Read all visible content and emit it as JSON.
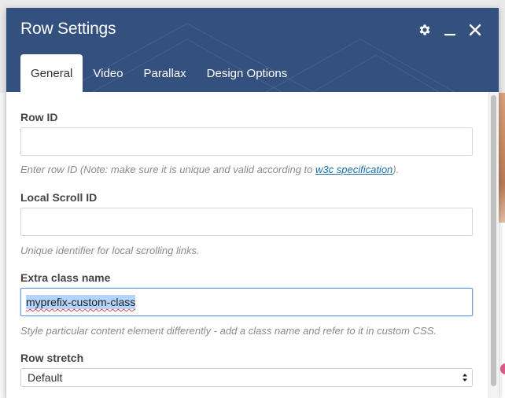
{
  "dialog": {
    "title": "Row Settings",
    "header_color": "#34507f",
    "controls": [
      {
        "name": "settings",
        "icon": "gear-icon"
      },
      {
        "name": "minimize",
        "icon": "minimize-icon"
      },
      {
        "name": "close",
        "icon": "close-icon"
      }
    ]
  },
  "tabs": [
    {
      "label": "General",
      "active": true
    },
    {
      "label": "Video",
      "active": false
    },
    {
      "label": "Parallax",
      "active": false
    },
    {
      "label": "Design Options",
      "active": false
    }
  ],
  "form": {
    "row_id": {
      "label": "Row ID",
      "value": "",
      "help_before": "Enter row ID (Note: make sure it is unique and valid according to ",
      "help_link": "w3c specification",
      "help_after": ")."
    },
    "local_scroll_id": {
      "label": "Local Scroll ID",
      "value": "",
      "help": "Unique identifier for local scrolling links."
    },
    "extra_class": {
      "label": "Extra class name",
      "value": "myprefix-custom-class",
      "help": "Style particular content element differently - add a class name and refer to it in custom CSS."
    },
    "row_stretch": {
      "label": "Row stretch",
      "selected": "Default"
    }
  },
  "accent_colors": {
    "link": "#1a6ea8",
    "focus_border": "#6ea0d6",
    "selection": "#b3d4fc"
  }
}
